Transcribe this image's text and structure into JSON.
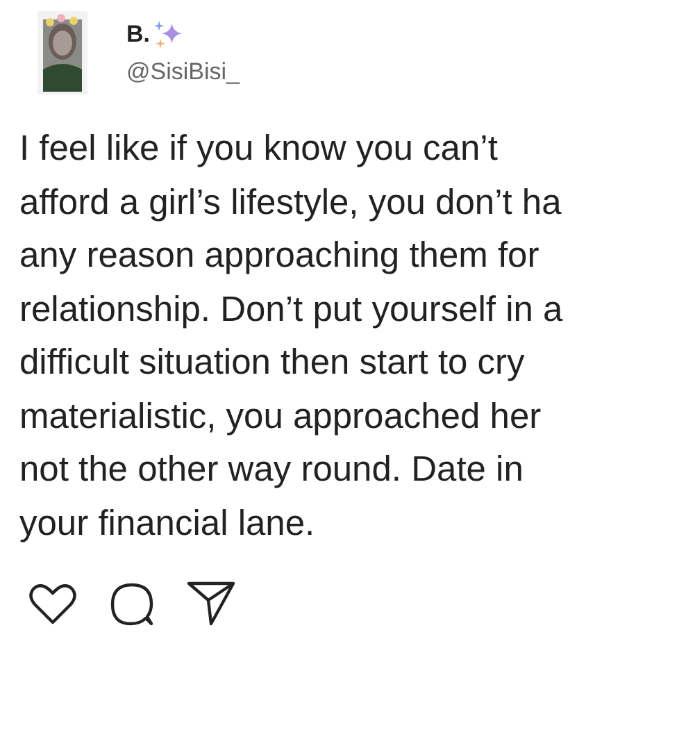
{
  "author": {
    "name": "B.",
    "handle": "@SisiBisi_"
  },
  "tweet_lines": [
    "I feel like if you know you can’t",
    "afford a girl’s lifestyle, you don’t ha",
    "any reason approaching them for",
    "relationship. Don’t put yourself in a",
    "difficult situation then start to cry",
    "materialistic, you approached her",
    "not the other way round. Date in",
    "your financial lane."
  ],
  "actions": [
    {
      "kind": "like"
    },
    {
      "kind": "reply"
    },
    {
      "kind": "share"
    }
  ]
}
